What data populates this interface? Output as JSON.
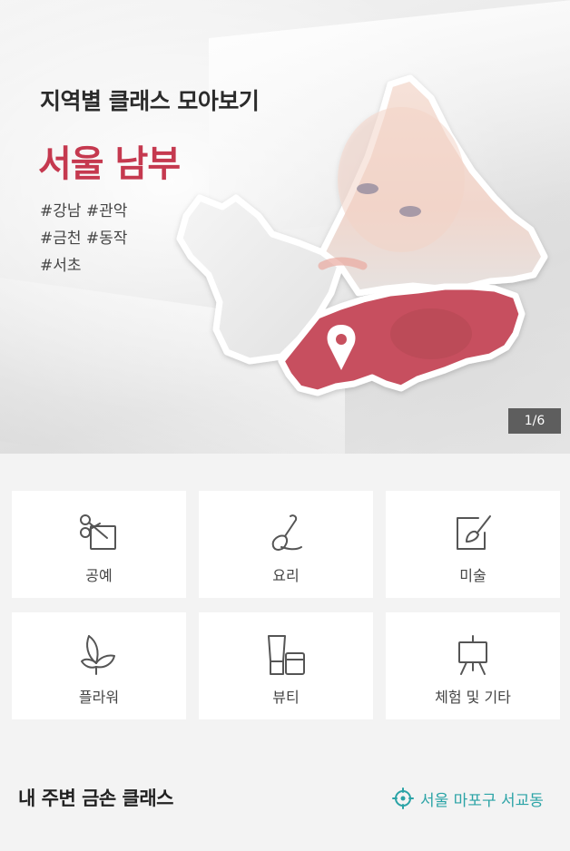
{
  "banner": {
    "subtitle": "지역별 클래스 모아보기",
    "title": "서울 남부",
    "tag_lines": [
      "#강남 #관악",
      "#금천 #동작",
      "#서초"
    ],
    "page_indicator": "1/6",
    "accent_color": "#c5394f"
  },
  "categories": [
    {
      "label": "공예",
      "icon": "craft-scissors-icon"
    },
    {
      "label": "요리",
      "icon": "cooking-spatula-icon"
    },
    {
      "label": "미술",
      "icon": "art-brush-icon"
    },
    {
      "label": "플라워",
      "icon": "flower-leaf-icon"
    },
    {
      "label": "뷰티",
      "icon": "beauty-cosmetics-icon"
    },
    {
      "label": "체험 및 기타",
      "icon": "easel-icon"
    }
  ],
  "nearby": {
    "title": "내 주변 금손 클래스",
    "location": "서울 마포구 서교동",
    "location_color": "#2aa3a6"
  }
}
